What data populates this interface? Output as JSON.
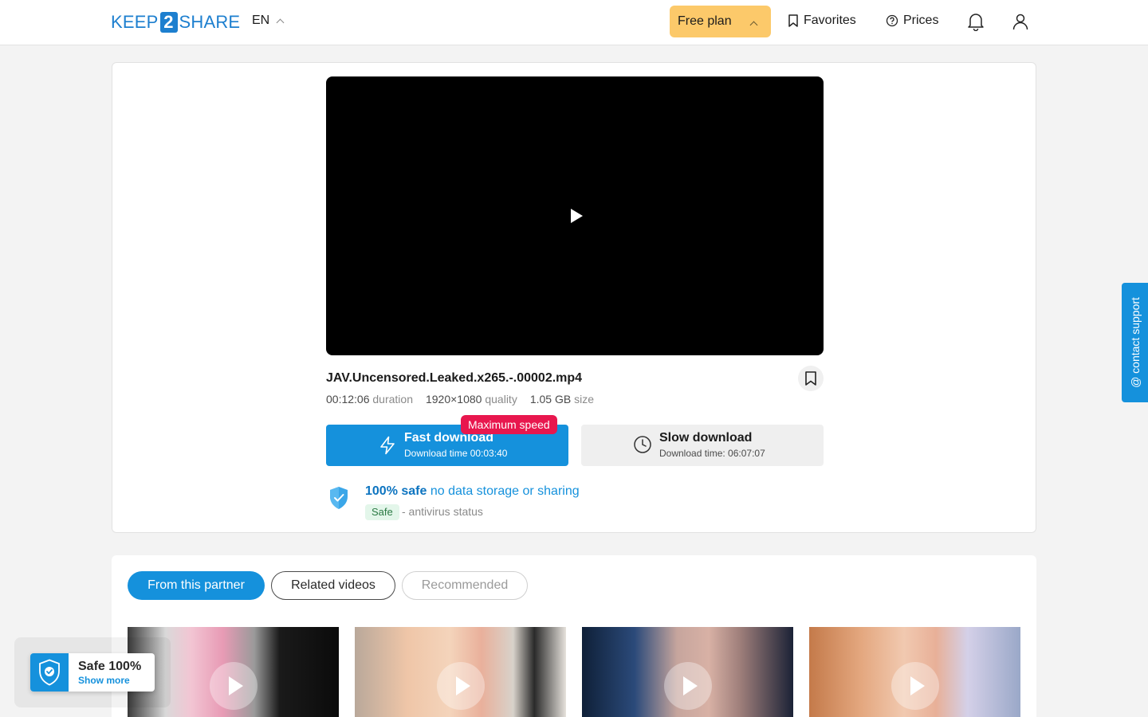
{
  "header": {
    "logo_left": "KEEP",
    "logo_num": "2",
    "logo_right": "SHARE",
    "language": "EN",
    "plan_label": "Free plan",
    "favorites_label": "Favorites",
    "prices_label": "Prices"
  },
  "file": {
    "name": "JAV.Uncensored.Leaked.x265.-.00002.mp4",
    "duration": "00:12:06",
    "duration_label": "duration",
    "quality": "1920×1080",
    "quality_label": "quality",
    "size": "1.05 GB",
    "size_label": "size"
  },
  "downloads": {
    "fast_title": "Fast download",
    "fast_time": "Download time 00:03:40",
    "fast_badge": "Maximum speed",
    "slow_title": "Slow download",
    "slow_time": "Download time: 06:07:07"
  },
  "safety": {
    "headline_bold": "100% safe",
    "headline_rest": "no data storage or sharing",
    "status_badge": "Safe",
    "status_text": "- antivirus status"
  },
  "tabs": [
    {
      "label": "From this partner",
      "state": "active"
    },
    {
      "label": "Related videos",
      "state": "normal"
    },
    {
      "label": "Recommended",
      "state": "disabled"
    }
  ],
  "support_label": "@ contact support",
  "safe_widget": {
    "title": "Safe 100%",
    "link": "Show more"
  },
  "colors": {
    "accent": "#1591dc",
    "plan": "#fcc96a",
    "badge": "#e8174e"
  },
  "icons": [
    "bookmark-icon",
    "help-circle-icon",
    "bell-icon",
    "user-icon",
    "lightning-icon",
    "clock-icon",
    "shield-check-icon",
    "play-icon"
  ]
}
